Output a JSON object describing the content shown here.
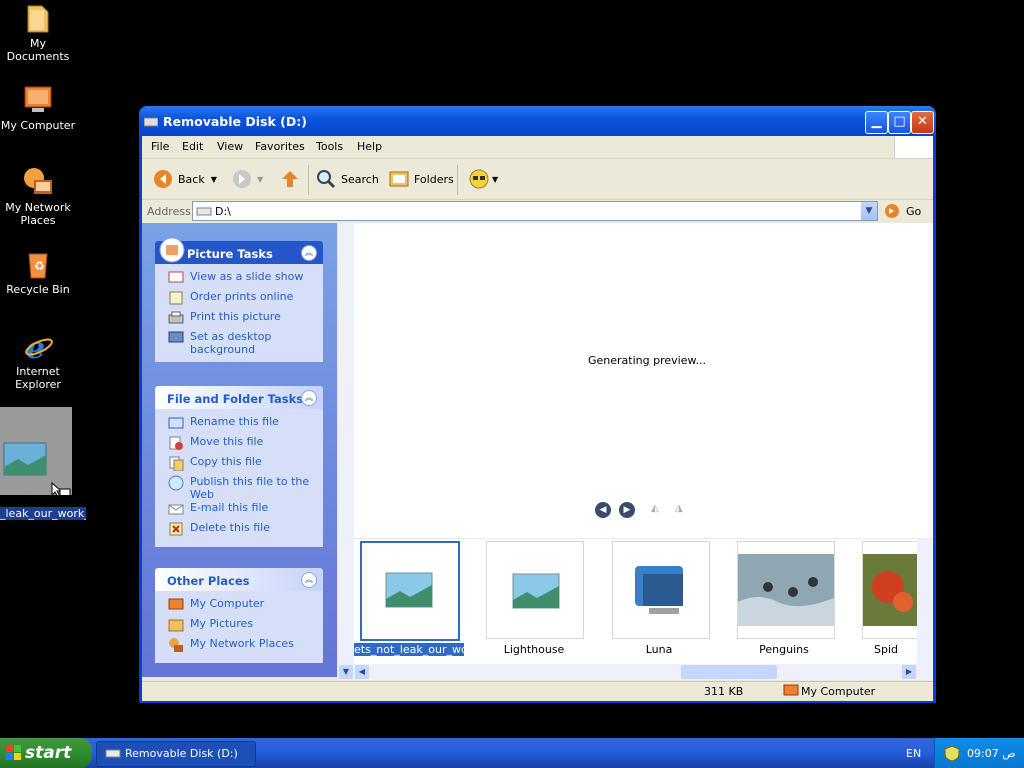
{
  "desktop": {
    "icons": [
      {
        "label": "My Documents"
      },
      {
        "label": "My Computer"
      },
      {
        "label": "My Network Places"
      },
      {
        "label": "Recycle Bin"
      },
      {
        "label": "Internet Explorer"
      }
    ],
    "dragged_label": "_leak_our_work_ remix"
  },
  "window": {
    "title": "Removable Disk (D:)",
    "menu": [
      "File",
      "Edit",
      "View",
      "Favorites",
      "Tools",
      "Help"
    ],
    "toolbar": {
      "back": "Back",
      "search": "Search",
      "folders": "Folders"
    },
    "address": {
      "label": "Address",
      "value": "D:\\",
      "go": "Go"
    },
    "panels": {
      "picture_tasks": {
        "title": "Picture Tasks",
        "items": [
          "View as a slide show",
          "Order prints online",
          "Print this picture",
          "Set as desktop background"
        ]
      },
      "file_tasks": {
        "title": "File and Folder Tasks",
        "items": [
          "Rename this file",
          "Move this file",
          "Copy this file",
          "Publish this file to the Web",
          "E-mail this file",
          "Delete this file"
        ]
      },
      "other_places": {
        "title": "Other Places",
        "items": [
          "My Computer",
          "My Pictures",
          "My Network Places"
        ]
      }
    },
    "preview_text": "Generating preview...",
    "thumbnails": [
      {
        "label": "ets_not_leak_our_work_ remix"
      },
      {
        "label": "Lighthouse"
      },
      {
        "label": "Luna"
      },
      {
        "label": "Penguins"
      },
      {
        "label": "Spid"
      }
    ],
    "status": {
      "size": "311 KB",
      "location": "My Computer"
    }
  },
  "taskbar": {
    "start": "start",
    "task_button": "Removable Disk (D:)",
    "language": "EN",
    "clock": "09:07 ص"
  },
  "colors": {
    "accent": "#316ac5",
    "titlebar": "#0a55dd",
    "link": "#215dc6"
  }
}
